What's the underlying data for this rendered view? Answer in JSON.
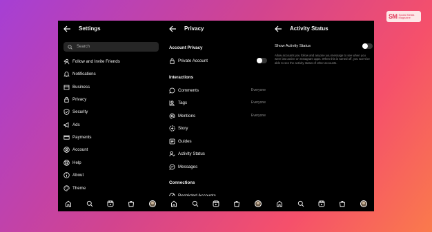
{
  "logo": {
    "mark": "SM",
    "text": "Social Media Magazine"
  },
  "settings": {
    "title": "Settings",
    "search_placeholder": "Search",
    "items": [
      {
        "label": "Follow and Invite Friends",
        "icon": "follow-icon"
      },
      {
        "label": "Notifications",
        "icon": "bell-icon"
      },
      {
        "label": "Business",
        "icon": "store-icon"
      },
      {
        "label": "Privacy",
        "icon": "lock-icon"
      },
      {
        "label": "Security",
        "icon": "shield-icon"
      },
      {
        "label": "Ads",
        "icon": "megaphone-icon"
      },
      {
        "label": "Payments",
        "icon": "card-icon"
      },
      {
        "label": "Account",
        "icon": "account-icon"
      },
      {
        "label": "Help",
        "icon": "help-icon"
      },
      {
        "label": "About",
        "icon": "info-icon"
      },
      {
        "label": "Theme",
        "icon": "palette-icon"
      }
    ]
  },
  "privacy": {
    "title": "Privacy",
    "section_account": "Account Privacy",
    "private_account": "Private Account",
    "section_interactions": "Interactions",
    "interactions": [
      {
        "label": "Comments",
        "value": "Everyone",
        "icon": "comment-icon"
      },
      {
        "label": "Tags",
        "value": "Everyone",
        "icon": "tag-icon"
      },
      {
        "label": "Mentions",
        "value": "Everyone",
        "icon": "at-icon"
      },
      {
        "label": "Story",
        "value": "",
        "icon": "story-icon"
      },
      {
        "label": "Guides",
        "value": "",
        "icon": "guides-icon"
      },
      {
        "label": "Activity Status",
        "value": "",
        "icon": "activity-icon"
      },
      {
        "label": "Messages",
        "value": "",
        "icon": "messages-icon"
      }
    ],
    "section_connections": "Connections",
    "restricted": "Restricted Accounts"
  },
  "activity": {
    "title": "Activity Status",
    "show_label": "Show Activity Status",
    "description": "Allow accounts you follow and anyone you message to see when you were last active on Instagram apps. When this is turned off, you won't be able to see the activity status of other accounts."
  }
}
